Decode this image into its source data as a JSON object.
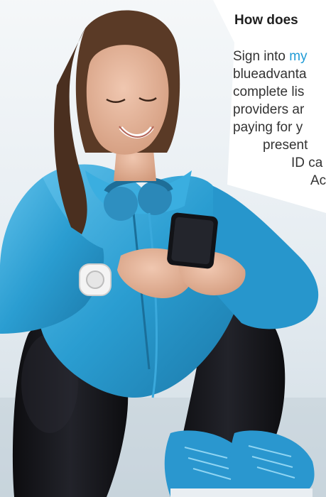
{
  "article": {
    "heading": "How does",
    "lines": [
      {
        "prefix": "Sign into ",
        "link": "my"
      },
      {
        "text": "blueadvanta"
      },
      {
        "text": "complete lis"
      },
      {
        "text": "providers ar"
      },
      {
        "text": "paying for y"
      },
      {
        "text": "present"
      },
      {
        "text": "ID ca"
      },
      {
        "text": "Ac"
      }
    ]
  },
  "photo": {
    "subject": "woman-using-smartphone",
    "colors": {
      "jacket": "#2d9fd0",
      "hair": "#5a3a26",
      "skin": "#e3b39a",
      "sky": "#dfe8ee"
    }
  }
}
